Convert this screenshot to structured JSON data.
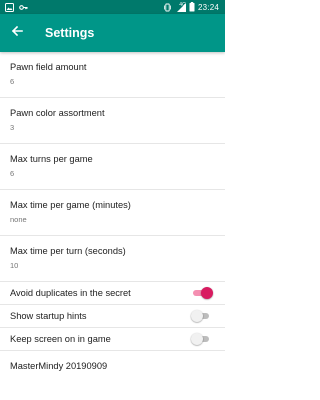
{
  "status_bar": {
    "time": "23:24",
    "network": "4G",
    "left_icons": [
      "image-icon",
      "key-icon"
    ],
    "right_icons": [
      "vibrate-icon",
      "signal-icon",
      "battery-icon"
    ]
  },
  "app_bar": {
    "title": "Settings",
    "background": "#009688",
    "status_color": "#00796b"
  },
  "settings": {
    "pawn_field_amount": {
      "title": "Pawn field amount",
      "value": "6"
    },
    "pawn_color_assortment": {
      "title": "Pawn color assortment",
      "value": "3"
    },
    "max_turns": {
      "title": "Max turns per game",
      "value": "6"
    },
    "max_time_game": {
      "title": "Max time per game (minutes)",
      "value": "none"
    },
    "max_time_turn": {
      "title": "Max time per turn (seconds)",
      "value": "10"
    },
    "avoid_duplicates": {
      "title": "Avoid duplicates in the secret",
      "enabled": true
    },
    "startup_hints": {
      "title": "Show startup hints",
      "enabled": false
    },
    "keep_screen_on": {
      "title": "Keep screen on in game",
      "enabled": false
    }
  },
  "footer": {
    "version": "MasterMindy 20190909"
  },
  "colors": {
    "accent": "#d81b60",
    "primary": "#009688"
  }
}
